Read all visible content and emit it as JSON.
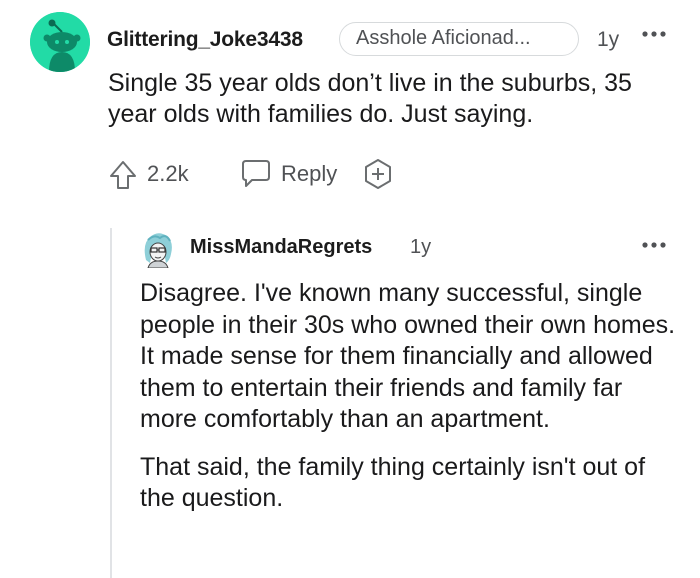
{
  "comment": {
    "username": "Glittering_Joke3438",
    "flair": "Asshole Aficionad...",
    "age": "1y",
    "text": "Single 35 year olds don’t live in the suburbs, 35 year olds with families do. Just saying.",
    "avatar_color": "#22dba6",
    "actions": {
      "upvote_icon": "upvote-arrow-icon",
      "score": "2.2k",
      "reply_icon": "speech-bubble-icon",
      "reply_label": "Reply",
      "award_icon": "award-plus-icon"
    }
  },
  "reply": {
    "username": "MissMandaRegrets",
    "age": "1y",
    "paragraphs": [
      "Disagree. I've known many successful, single people in their 30s who owned their own homes. It made sense for them financially and allowed them to entertain their friends and family far more comfortably than an apartment.",
      "That said, the family thing certainly isn't out of the question."
    ]
  },
  "colors": {
    "text": "#1a1a1b",
    "meta": "#505255",
    "border": "#d7dadc",
    "thread_line": "#e1e3e6"
  }
}
